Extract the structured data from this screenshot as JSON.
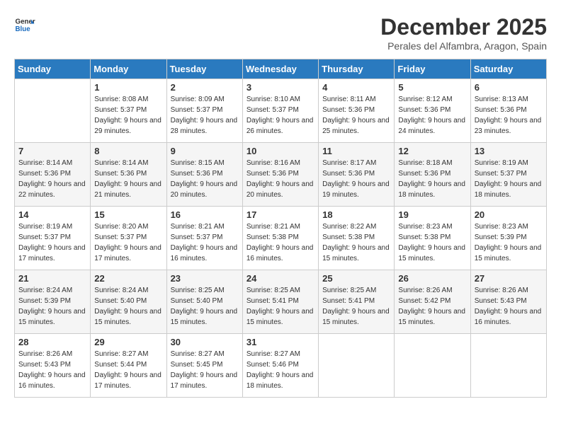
{
  "header": {
    "logo_line1": "General",
    "logo_line2": "Blue",
    "month": "December 2025",
    "location": "Perales del Alfambra, Aragon, Spain"
  },
  "weekdays": [
    "Sunday",
    "Monday",
    "Tuesday",
    "Wednesday",
    "Thursday",
    "Friday",
    "Saturday"
  ],
  "weeks": [
    [
      {
        "day": "",
        "sunrise": "",
        "sunset": "",
        "daylight": ""
      },
      {
        "day": "1",
        "sunrise": "Sunrise: 8:08 AM",
        "sunset": "Sunset: 5:37 PM",
        "daylight": "Daylight: 9 hours and 29 minutes."
      },
      {
        "day": "2",
        "sunrise": "Sunrise: 8:09 AM",
        "sunset": "Sunset: 5:37 PM",
        "daylight": "Daylight: 9 hours and 28 minutes."
      },
      {
        "day": "3",
        "sunrise": "Sunrise: 8:10 AM",
        "sunset": "Sunset: 5:37 PM",
        "daylight": "Daylight: 9 hours and 26 minutes."
      },
      {
        "day": "4",
        "sunrise": "Sunrise: 8:11 AM",
        "sunset": "Sunset: 5:36 PM",
        "daylight": "Daylight: 9 hours and 25 minutes."
      },
      {
        "day": "5",
        "sunrise": "Sunrise: 8:12 AM",
        "sunset": "Sunset: 5:36 PM",
        "daylight": "Daylight: 9 hours and 24 minutes."
      },
      {
        "day": "6",
        "sunrise": "Sunrise: 8:13 AM",
        "sunset": "Sunset: 5:36 PM",
        "daylight": "Daylight: 9 hours and 23 minutes."
      }
    ],
    [
      {
        "day": "7",
        "sunrise": "Sunrise: 8:14 AM",
        "sunset": "Sunset: 5:36 PM",
        "daylight": "Daylight: 9 hours and 22 minutes."
      },
      {
        "day": "8",
        "sunrise": "Sunrise: 8:14 AM",
        "sunset": "Sunset: 5:36 PM",
        "daylight": "Daylight: 9 hours and 21 minutes."
      },
      {
        "day": "9",
        "sunrise": "Sunrise: 8:15 AM",
        "sunset": "Sunset: 5:36 PM",
        "daylight": "Daylight: 9 hours and 20 minutes."
      },
      {
        "day": "10",
        "sunrise": "Sunrise: 8:16 AM",
        "sunset": "Sunset: 5:36 PM",
        "daylight": "Daylight: 9 hours and 20 minutes."
      },
      {
        "day": "11",
        "sunrise": "Sunrise: 8:17 AM",
        "sunset": "Sunset: 5:36 PM",
        "daylight": "Daylight: 9 hours and 19 minutes."
      },
      {
        "day": "12",
        "sunrise": "Sunrise: 8:18 AM",
        "sunset": "Sunset: 5:36 PM",
        "daylight": "Daylight: 9 hours and 18 minutes."
      },
      {
        "day": "13",
        "sunrise": "Sunrise: 8:19 AM",
        "sunset": "Sunset: 5:37 PM",
        "daylight": "Daylight: 9 hours and 18 minutes."
      }
    ],
    [
      {
        "day": "14",
        "sunrise": "Sunrise: 8:19 AM",
        "sunset": "Sunset: 5:37 PM",
        "daylight": "Daylight: 9 hours and 17 minutes."
      },
      {
        "day": "15",
        "sunrise": "Sunrise: 8:20 AM",
        "sunset": "Sunset: 5:37 PM",
        "daylight": "Daylight: 9 hours and 17 minutes."
      },
      {
        "day": "16",
        "sunrise": "Sunrise: 8:21 AM",
        "sunset": "Sunset: 5:37 PM",
        "daylight": "Daylight: 9 hours and 16 minutes."
      },
      {
        "day": "17",
        "sunrise": "Sunrise: 8:21 AM",
        "sunset": "Sunset: 5:38 PM",
        "daylight": "Daylight: 9 hours and 16 minutes."
      },
      {
        "day": "18",
        "sunrise": "Sunrise: 8:22 AM",
        "sunset": "Sunset: 5:38 PM",
        "daylight": "Daylight: 9 hours and 15 minutes."
      },
      {
        "day": "19",
        "sunrise": "Sunrise: 8:23 AM",
        "sunset": "Sunset: 5:38 PM",
        "daylight": "Daylight: 9 hours and 15 minutes."
      },
      {
        "day": "20",
        "sunrise": "Sunrise: 8:23 AM",
        "sunset": "Sunset: 5:39 PM",
        "daylight": "Daylight: 9 hours and 15 minutes."
      }
    ],
    [
      {
        "day": "21",
        "sunrise": "Sunrise: 8:24 AM",
        "sunset": "Sunset: 5:39 PM",
        "daylight": "Daylight: 9 hours and 15 minutes."
      },
      {
        "day": "22",
        "sunrise": "Sunrise: 8:24 AM",
        "sunset": "Sunset: 5:40 PM",
        "daylight": "Daylight: 9 hours and 15 minutes."
      },
      {
        "day": "23",
        "sunrise": "Sunrise: 8:25 AM",
        "sunset": "Sunset: 5:40 PM",
        "daylight": "Daylight: 9 hours and 15 minutes."
      },
      {
        "day": "24",
        "sunrise": "Sunrise: 8:25 AM",
        "sunset": "Sunset: 5:41 PM",
        "daylight": "Daylight: 9 hours and 15 minutes."
      },
      {
        "day": "25",
        "sunrise": "Sunrise: 8:25 AM",
        "sunset": "Sunset: 5:41 PM",
        "daylight": "Daylight: 9 hours and 15 minutes."
      },
      {
        "day": "26",
        "sunrise": "Sunrise: 8:26 AM",
        "sunset": "Sunset: 5:42 PM",
        "daylight": "Daylight: 9 hours and 15 minutes."
      },
      {
        "day": "27",
        "sunrise": "Sunrise: 8:26 AM",
        "sunset": "Sunset: 5:43 PM",
        "daylight": "Daylight: 9 hours and 16 minutes."
      }
    ],
    [
      {
        "day": "28",
        "sunrise": "Sunrise: 8:26 AM",
        "sunset": "Sunset: 5:43 PM",
        "daylight": "Daylight: 9 hours and 16 minutes."
      },
      {
        "day": "29",
        "sunrise": "Sunrise: 8:27 AM",
        "sunset": "Sunset: 5:44 PM",
        "daylight": "Daylight: 9 hours and 17 minutes."
      },
      {
        "day": "30",
        "sunrise": "Sunrise: 8:27 AM",
        "sunset": "Sunset: 5:45 PM",
        "daylight": "Daylight: 9 hours and 17 minutes."
      },
      {
        "day": "31",
        "sunrise": "Sunrise: 8:27 AM",
        "sunset": "Sunset: 5:46 PM",
        "daylight": "Daylight: 9 hours and 18 minutes."
      },
      {
        "day": "",
        "sunrise": "",
        "sunset": "",
        "daylight": ""
      },
      {
        "day": "",
        "sunrise": "",
        "sunset": "",
        "daylight": ""
      },
      {
        "day": "",
        "sunrise": "",
        "sunset": "",
        "daylight": ""
      }
    ]
  ]
}
